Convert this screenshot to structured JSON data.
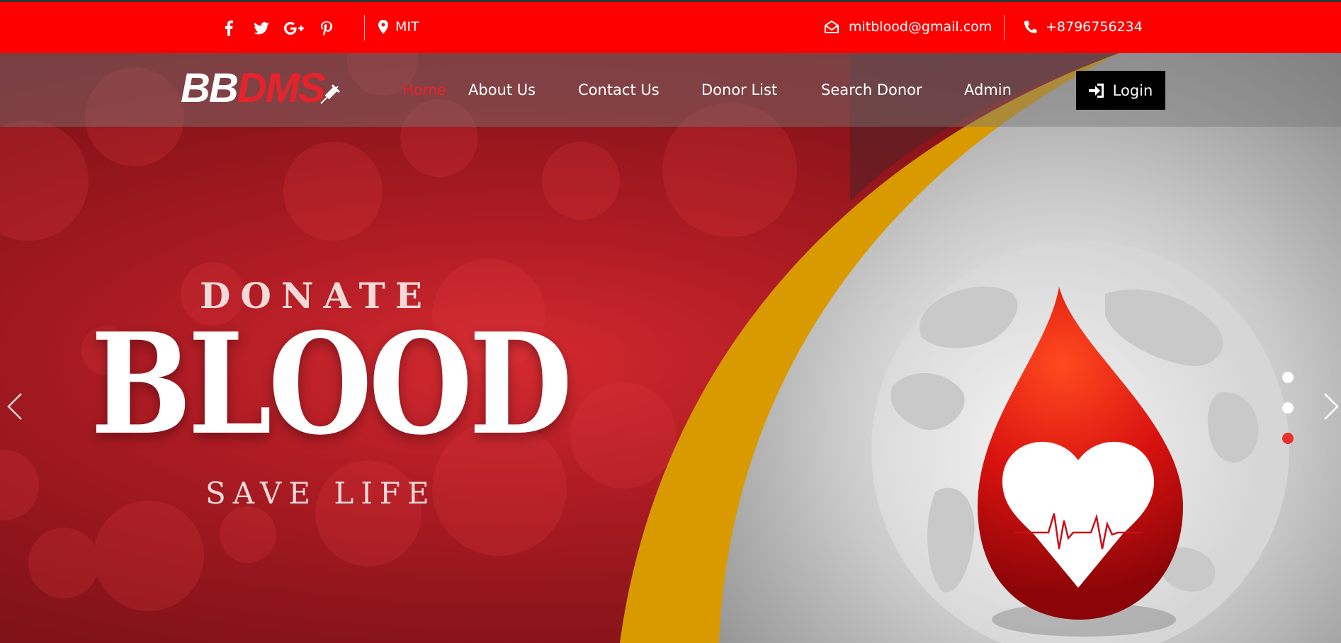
{
  "topbar": {
    "social_icons": [
      "facebook-icon",
      "twitter-icon",
      "google-plus-icon",
      "pinterest-icon"
    ],
    "location": "MIT",
    "email": "mitblood@gmail.com",
    "phone": "+8796756234"
  },
  "navbar": {
    "logo_part1": "BB",
    "logo_part2": "DMS",
    "items": [
      {
        "label": "Home",
        "active": true
      },
      {
        "label": "About Us"
      },
      {
        "label": "Contact Us"
      },
      {
        "label": "Donor List"
      },
      {
        "label": "Search Donor"
      },
      {
        "label": "Admin"
      }
    ],
    "login_label": "Login"
  },
  "slide": {
    "line1": "DONATE",
    "line2": "BLOOD",
    "line3": "SAVE LIFE"
  },
  "carousel": {
    "slide_count": 3,
    "active_index": 2
  },
  "colors": {
    "topbar": "#ff0000",
    "brand_red": "#e8222a",
    "gold_swoosh": "#d99a00",
    "login_bg": "#000000"
  }
}
